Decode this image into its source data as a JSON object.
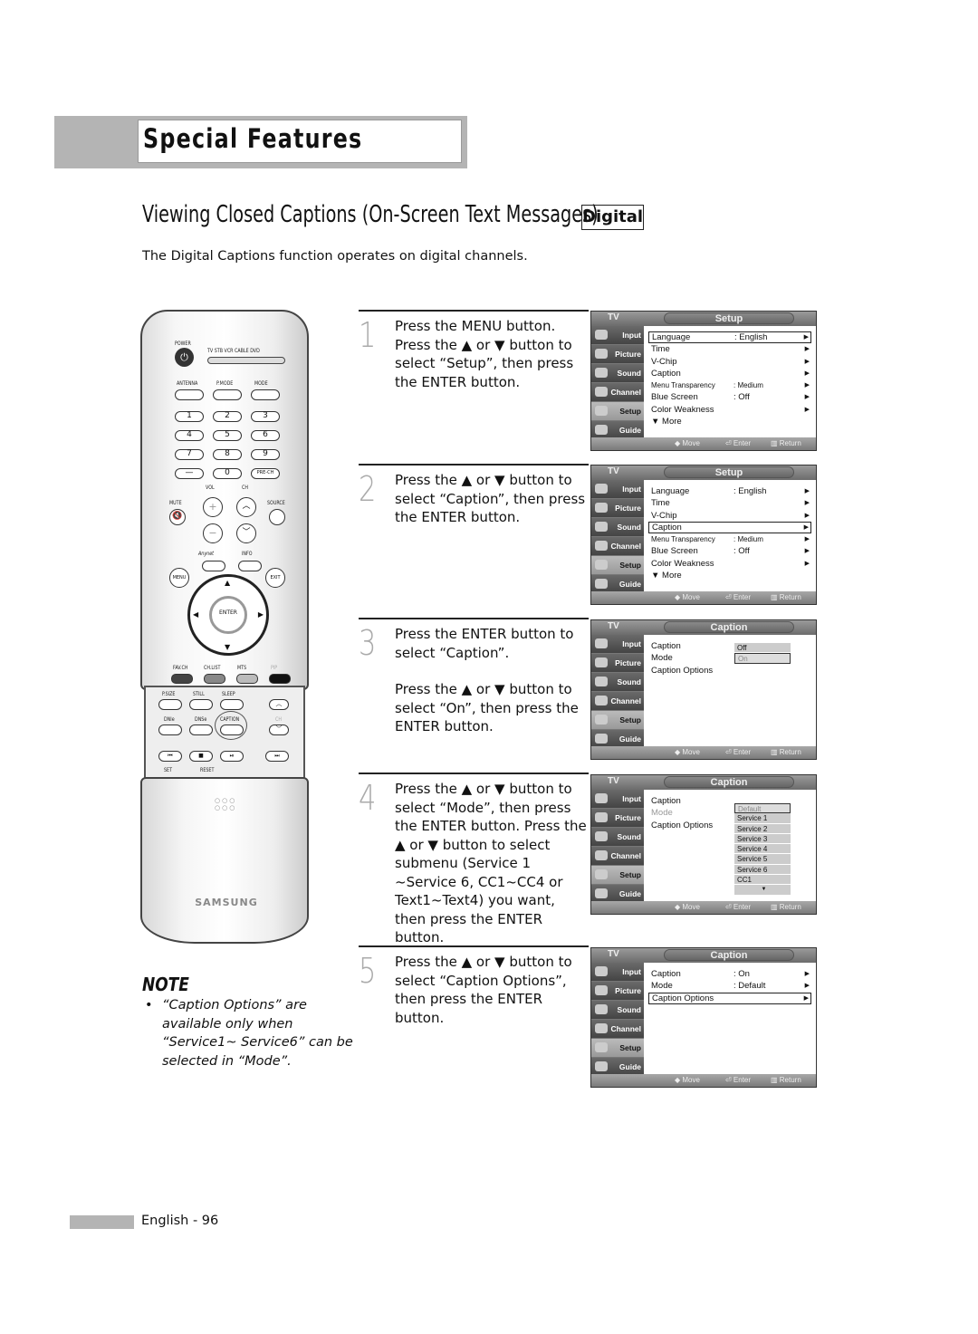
{
  "header": {
    "section": "Special Features"
  },
  "title": {
    "text": "Viewing Closed Captions (On-Screen Text Messages)",
    "badge": "Digital"
  },
  "intro": "The Digital Captions function operates on digital channels.",
  "remote": {
    "power": "POWER",
    "sources": "TV  STB  VCR  CABLE  DVD",
    "row_labels": [
      "ANTENNA",
      "P.MODE",
      "MODE"
    ],
    "digits": [
      "1",
      "2",
      "3",
      "4",
      "5",
      "6",
      "7",
      "8",
      "9",
      "—",
      "0",
      "PRE-CH"
    ],
    "vol": "VOL",
    "ch": "CH",
    "mute": "MUTE",
    "source": "SOURCE",
    "anynet": "Anynet",
    "info": "INFO",
    "menu": "MENU",
    "exit": "EXIT",
    "enter": "ENTER",
    "color_labels": [
      "FAV.CH",
      "CH.LIST",
      "MTS",
      "PIP"
    ],
    "lower_labels": [
      "P.SIZE",
      "STILL",
      "SLEEP",
      "DNIe",
      "DNSe",
      "CAPTION",
      "CH"
    ],
    "set": "SET",
    "reset": "RESET",
    "brand": "SAMSUNG"
  },
  "note": {
    "title": "NOTE",
    "bullet": "“Caption Options” are available only when “Service1~ Service6” can be selected in “Mode”."
  },
  "steps": [
    {
      "num": "1",
      "paras": [
        "Press the MENU button. Press the ▲ or ▼ button to select “Setup”, then press the ENTER button."
      ]
    },
    {
      "num": "2",
      "paras": [
        "Press the ▲ or ▼ button to select “Caption”, then press the ENTER button."
      ]
    },
    {
      "num": "3",
      "paras": [
        "Press the ENTER button to select “Caption”.",
        "Press the ▲ or ▼ button to select “On”, then press the ENTER button."
      ]
    },
    {
      "num": "4",
      "paras": [
        "Press the ▲ or ▼ button to select “Mode”, then press the ENTER button. Press the ▲ or ▼ button to select submenu (Service 1 ~Service 6, CC1~CC4 or Text1~Text4) you want, then press the ENTER button."
      ]
    },
    {
      "num": "5",
      "paras": [
        "Press the ▲ or ▼ button to select “Caption Options”, then press the ENTER button."
      ]
    }
  ],
  "tv_common": {
    "label": "TV",
    "sidebar": [
      "Input",
      "Picture",
      "Sound",
      "Channel",
      "Setup",
      "Guide"
    ],
    "hints": {
      "move": "◆ Move",
      "enter": "⏎ Enter",
      "return": "▥ Return"
    }
  },
  "screens": [
    {
      "title": "Setup",
      "rows": [
        {
          "label": "Language",
          "value": ": English",
          "arrow": "▶",
          "sel": true
        },
        {
          "label": "Time",
          "value": "",
          "arrow": "▶"
        },
        {
          "label": "V-Chip",
          "value": "",
          "arrow": "▶"
        },
        {
          "label": "Caption",
          "value": "",
          "arrow": "▶"
        },
        {
          "label": "Menu Transparency",
          "value": ": Medium",
          "arrow": "▶",
          "small": true
        },
        {
          "label": "Blue Screen",
          "value": ": Off",
          "arrow": "▶"
        },
        {
          "label": "Color Weakness",
          "value": "",
          "arrow": "▶"
        },
        {
          "label": "▼ More",
          "value": "",
          "arrow": ""
        }
      ]
    },
    {
      "title": "Setup",
      "rows": [
        {
          "label": "Language",
          "value": ": English",
          "arrow": "▶"
        },
        {
          "label": "Time",
          "value": "",
          "arrow": "▶"
        },
        {
          "label": "V-Chip",
          "value": "",
          "arrow": "▶"
        },
        {
          "label": "Caption",
          "value": "",
          "arrow": "▶",
          "sel": true
        },
        {
          "label": "Menu Transparency",
          "value": ": Medium",
          "arrow": "▶",
          "small": true
        },
        {
          "label": "Blue Screen",
          "value": ": Off",
          "arrow": "▶"
        },
        {
          "label": "Color Weakness",
          "value": "",
          "arrow": "▶"
        },
        {
          "label": "▼ More",
          "value": "",
          "arrow": ""
        }
      ]
    },
    {
      "title": "Caption",
      "rows": [
        {
          "label": "Caption",
          "value": "",
          "arrow": ""
        },
        {
          "label": "Mode",
          "value": "",
          "arrow": ""
        },
        {
          "label": "Caption Options",
          "value": "",
          "arrow": ""
        }
      ],
      "options": [
        {
          "label": "Off"
        },
        {
          "label": "On",
          "sel": true
        }
      ]
    },
    {
      "title": "Caption",
      "rows": [
        {
          "label": "Caption",
          "value": "",
          "arrow": ""
        },
        {
          "label": "Mode",
          "value": "",
          "arrow": "",
          "dim": true
        },
        {
          "label": "Caption Options",
          "value": "",
          "arrow": ""
        }
      ],
      "options": [
        {
          "label": "Default",
          "sel": true
        },
        {
          "label": "Service 1"
        },
        {
          "label": "Service 2"
        },
        {
          "label": "Service 3"
        },
        {
          "label": "Service 4"
        },
        {
          "label": "Service 5"
        },
        {
          "label": "Service 6"
        },
        {
          "label": "CC1"
        },
        {
          "label": "▼"
        }
      ]
    },
    {
      "title": "Caption",
      "rows": [
        {
          "label": "Caption",
          "value": ": On",
          "arrow": "▶"
        },
        {
          "label": "Mode",
          "value": ": Default",
          "arrow": "▶"
        },
        {
          "label": "Caption Options",
          "value": "",
          "arrow": "▶",
          "sel": true
        }
      ]
    }
  ],
  "footer": {
    "page": "English - 96"
  }
}
